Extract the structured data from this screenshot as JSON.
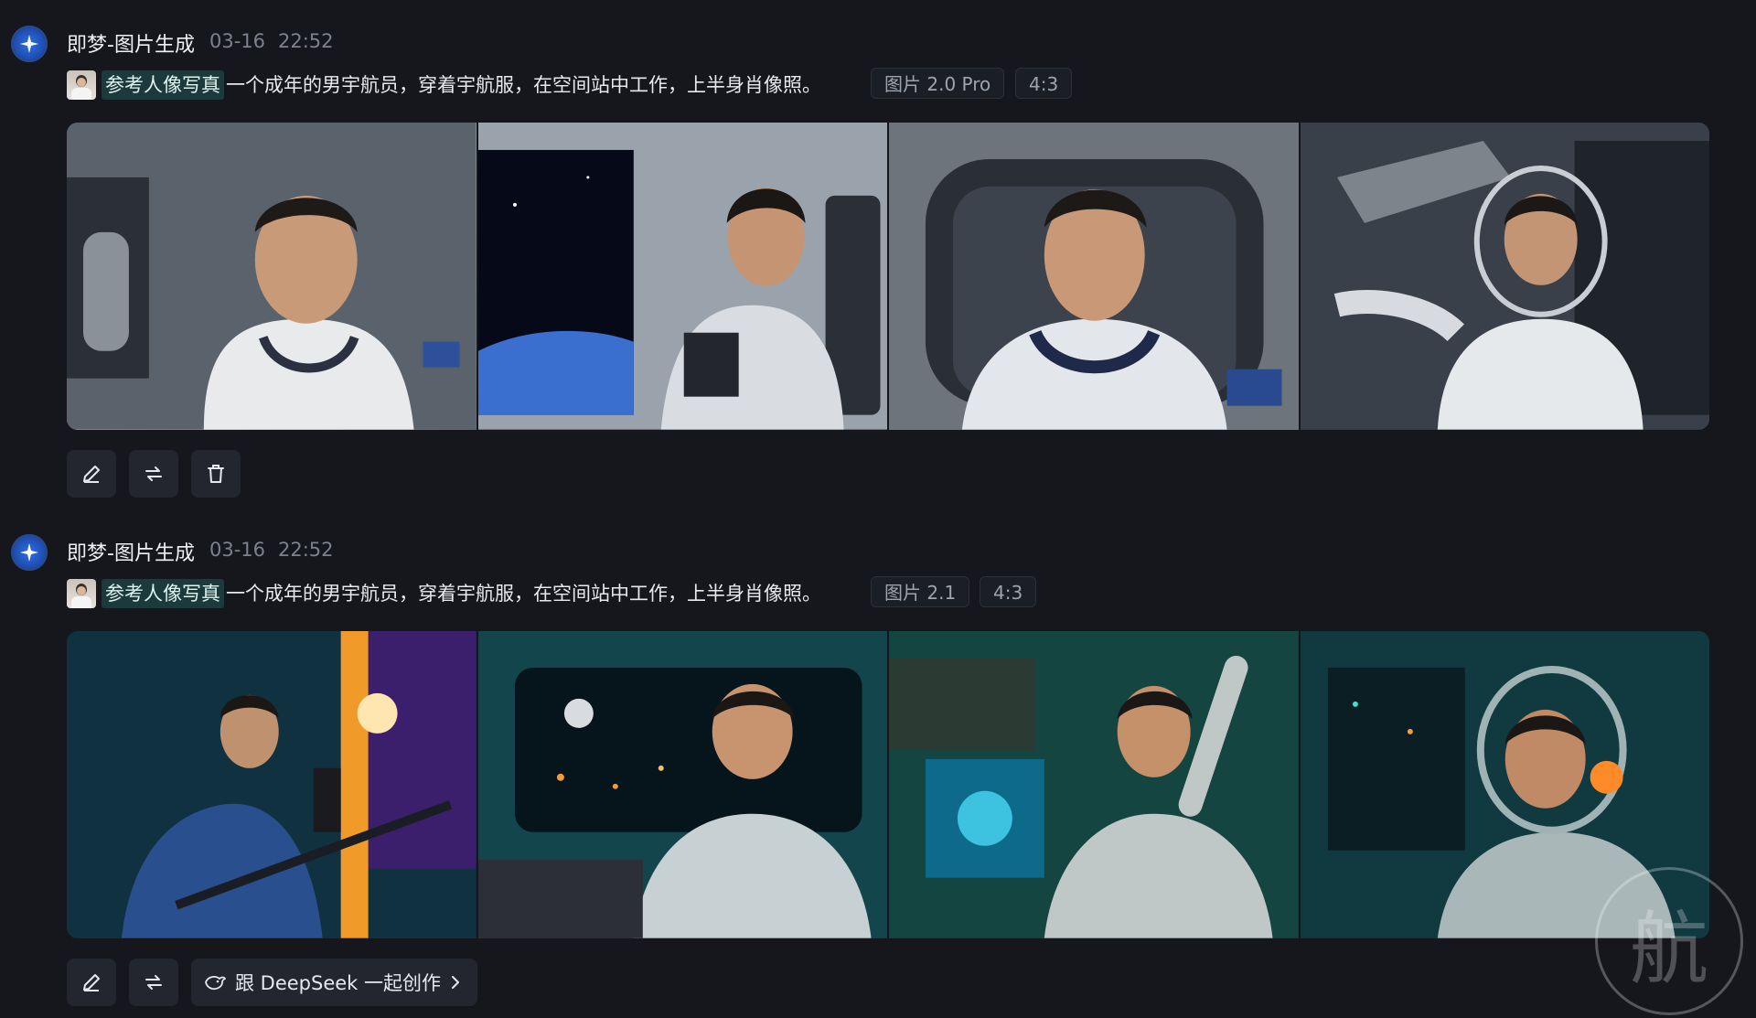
{
  "posts": [
    {
      "author": "即梦-图片生成",
      "date": "03-16",
      "time": "22:52",
      "ref_label": "参考人像写真",
      "prompt": "一个成年的男宇航员，穿着宇航服，在空间站中工作，上半身肖像照。",
      "model_tag": "图片 2.0 Pro",
      "ratio_tag": "4:3",
      "images": [
        {
          "alt": "astronaut-portrait-1"
        },
        {
          "alt": "astronaut-portrait-2"
        },
        {
          "alt": "astronaut-portrait-3"
        },
        {
          "alt": "astronaut-portrait-4"
        }
      ],
      "actions": [
        "edit-icon",
        "regenerate-icon",
        "delete-icon"
      ]
    },
    {
      "author": "即梦-图片生成",
      "date": "03-16",
      "time": "22:52",
      "ref_label": "参考人像写真",
      "prompt": "一个成年的男宇航员，穿着宇航服，在空间站中工作，上半身肖像照。",
      "model_tag": "图片 2.1",
      "ratio_tag": "4:3",
      "images": [
        {
          "alt": "astronaut-portrait-5"
        },
        {
          "alt": "astronaut-portrait-6"
        },
        {
          "alt": "astronaut-portrait-7"
        },
        {
          "alt": "astronaut-portrait-8"
        }
      ],
      "actions": [
        "edit-icon",
        "regenerate-icon"
      ],
      "deepseek_button": "跟 DeepSeek 一起创作"
    }
  ],
  "watermark": "航",
  "colors": {
    "background": "#15171d",
    "ref_label_bg": "#1c3a3c",
    "logo_blue": "#2f6fe6"
  }
}
